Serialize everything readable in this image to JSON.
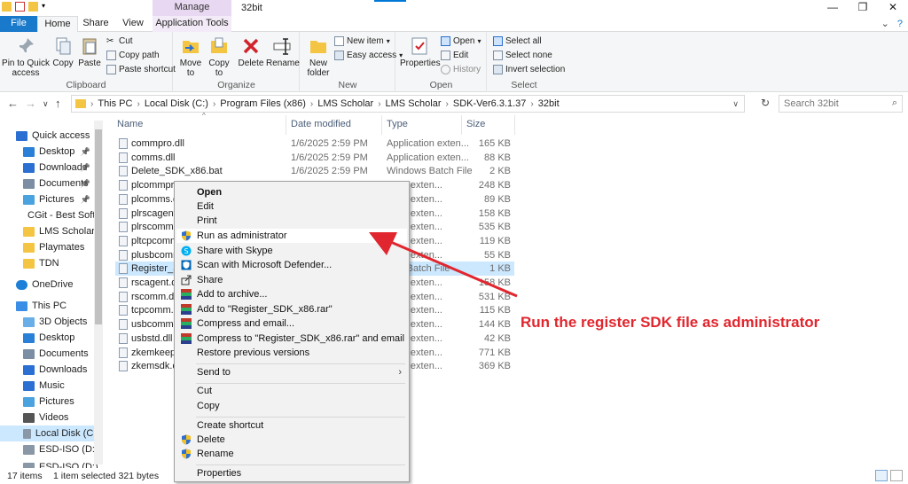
{
  "titlebar": {
    "manage_label": "Manage",
    "window_title": "32bit",
    "minimize": "—",
    "maximize": "❐",
    "close": "✕"
  },
  "tabs": {
    "file": "File",
    "home": "Home",
    "share": "Share",
    "view": "View",
    "app_tools": "Application Tools"
  },
  "ribbon": {
    "clipboard": {
      "label": "Clipboard",
      "pin_to_quick_access": "Pin to Quick access",
      "copy": "Copy",
      "paste": "Paste",
      "cut": "Cut",
      "copy_path": "Copy path",
      "paste_shortcut": "Paste shortcut"
    },
    "organize": {
      "label": "Organize",
      "move_to": "Move to",
      "copy_to": "Copy to",
      "delete": "Delete",
      "rename": "Rename"
    },
    "new": {
      "label": "New",
      "new_folder": "New folder",
      "new_item": "New item",
      "easy_access": "Easy access"
    },
    "open": {
      "label": "Open",
      "properties": "Properties",
      "open": "Open",
      "edit": "Edit",
      "history": "History"
    },
    "select": {
      "label": "Select",
      "select_all": "Select all",
      "select_none": "Select none",
      "invert_selection": "Invert selection"
    }
  },
  "address": {
    "crumbs": [
      "This PC",
      "Local Disk (C:)",
      "Program Files (x86)",
      "LMS Scholar",
      "LMS Scholar",
      "SDK-Ver6.3.1.37",
      "32bit"
    ],
    "search_placeholder": "Search 32bit"
  },
  "nav": {
    "items": [
      {
        "label": "Quick access",
        "icon": "star-icon"
      },
      {
        "label": "Desktop",
        "icon": "desktop-icon"
      },
      {
        "label": "Downloads",
        "icon": "download-icon"
      },
      {
        "label": "Documents",
        "icon": "document-icon"
      },
      {
        "label": "Pictures",
        "icon": "pictures-icon"
      },
      {
        "label": "CGit - Best Softw",
        "icon": "folder-icon"
      },
      {
        "label": "LMS Scholar",
        "icon": "folder-icon"
      },
      {
        "label": "Playmates",
        "icon": "folder-icon"
      },
      {
        "label": "TDN",
        "icon": "folder-icon"
      },
      {
        "label": "OneDrive",
        "icon": "cloud-icon"
      },
      {
        "label": "This PC",
        "icon": "computer-icon"
      },
      {
        "label": "3D Objects",
        "icon": "cube-icon"
      },
      {
        "label": "Desktop",
        "icon": "desktop-icon"
      },
      {
        "label": "Documents",
        "icon": "document-icon"
      },
      {
        "label": "Downloads",
        "icon": "download-icon"
      },
      {
        "label": "Music",
        "icon": "music-icon"
      },
      {
        "label": "Pictures",
        "icon": "pictures-icon"
      },
      {
        "label": "Videos",
        "icon": "video-icon"
      },
      {
        "label": "Local Disk (C:)",
        "icon": "drive-icon"
      },
      {
        "label": "ESD-ISO (D:)",
        "icon": "drive-icon"
      },
      {
        "label": "ESD-ISO (D:)",
        "icon": "drive-icon"
      }
    ]
  },
  "columns": {
    "name": "Name",
    "date": "Date modified",
    "type": "Type",
    "size": "Size"
  },
  "files": [
    {
      "name": "commpro.dll",
      "date": "1/6/2025 2:59 PM",
      "type": "Application exten...",
      "size": "165 KB"
    },
    {
      "name": "comms.dll",
      "date": "1/6/2025 2:59 PM",
      "type": "Application exten...",
      "size": "88 KB"
    },
    {
      "name": "Delete_SDK_x86.bat",
      "date": "1/6/2025 2:59 PM",
      "type": "Windows Batch File",
      "size": "2 KB"
    },
    {
      "name": "plcommpro",
      "date": "",
      "type": "ation exten...",
      "size": "248 KB"
    },
    {
      "name": "plcomms.dll",
      "date": "",
      "type": "ation exten...",
      "size": "89 KB"
    },
    {
      "name": "plrscagent.c",
      "date": "",
      "type": "ation exten...",
      "size": "158 KB"
    },
    {
      "name": "plrscomm.d",
      "date": "",
      "type": "ation exten...",
      "size": "535 KB"
    },
    {
      "name": "pltcpcomm",
      "date": "",
      "type": "ation exten...",
      "size": "119 KB"
    },
    {
      "name": "plusbcomm",
      "date": "",
      "type": "ation exten...",
      "size": "55 KB"
    },
    {
      "name": "Register_SDI",
      "date": "",
      "type": "ows Batch File",
      "size": "1 KB"
    },
    {
      "name": "rscagent.dll",
      "date": "",
      "type": "ation exten...",
      "size": "158 KB"
    },
    {
      "name": "rscomm.dll",
      "date": "",
      "type": "ation exten...",
      "size": "531 KB"
    },
    {
      "name": "tcpcomm.d",
      "date": "",
      "type": "ation exten...",
      "size": "115 KB"
    },
    {
      "name": "usbcomm.d",
      "date": "",
      "type": "ation exten...",
      "size": "144 KB"
    },
    {
      "name": "usbstd.dll",
      "date": "",
      "type": "ation exten...",
      "size": "42 KB"
    },
    {
      "name": "zkemkeeper",
      "date": "",
      "type": "ation exten...",
      "size": "771 KB"
    },
    {
      "name": "zkemsdk.dll",
      "date": "",
      "type": "ation exten...",
      "size": "369 KB"
    }
  ],
  "context_menu": {
    "open": "Open",
    "edit": "Edit",
    "print": "Print",
    "run_as_admin": "Run as administrator",
    "share_skype": "Share with Skype",
    "scan_defender": "Scan with Microsoft Defender...",
    "share": "Share",
    "add_to_archive": "Add to archive...",
    "add_to_rar": "Add to \"Register_SDK_x86.rar\"",
    "compress_email": "Compress and email...",
    "compress_rar_email": "Compress to \"Register_SDK_x86.rar\" and email",
    "restore_versions": "Restore previous versions",
    "send_to": "Send to",
    "cut": "Cut",
    "copy": "Copy",
    "create_shortcut": "Create shortcut",
    "delete": "Delete",
    "rename": "Rename",
    "properties": "Properties"
  },
  "status": {
    "item_count": "17 items",
    "selection": "1 item selected  321 bytes"
  },
  "annotation": {
    "text": "Run the register SDK file as administrator",
    "color": "#e0262e"
  }
}
